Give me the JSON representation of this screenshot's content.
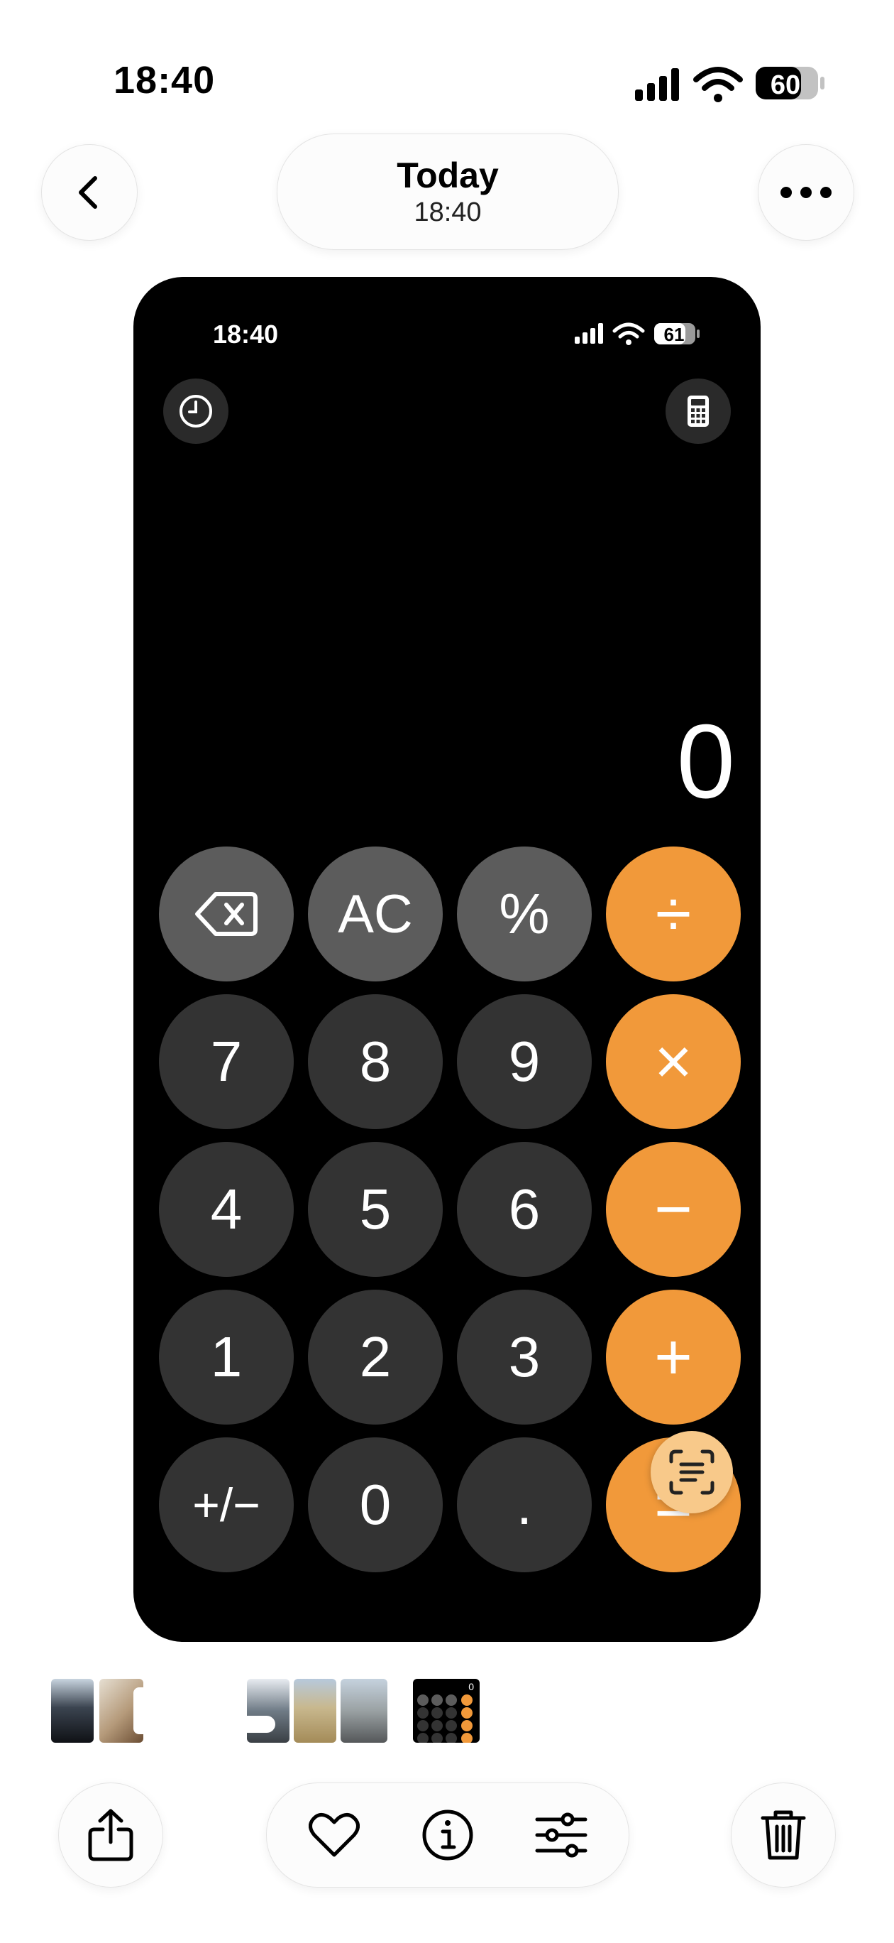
{
  "status_bar": {
    "time": "18:40",
    "battery": "60"
  },
  "nav": {
    "title": "Today",
    "subtitle": "18:40",
    "back_icon": "chevron-left-icon",
    "more_icon": "ellipsis-icon"
  },
  "screenshot": {
    "status_time": "18:40",
    "battery": "61",
    "display_value": "0",
    "keys": [
      [
        "⌫",
        "AC",
        "%",
        "÷"
      ],
      [
        "7",
        "8",
        "9",
        "×"
      ],
      [
        "4",
        "5",
        "6",
        "−"
      ],
      [
        "1",
        "2",
        "3",
        "+"
      ],
      [
        "+/−",
        "0",
        ".",
        "="
      ]
    ],
    "thumb_display": "0"
  },
  "toolbar": {
    "share_icon": "share-icon",
    "favorite_icon": "heart-icon",
    "info_icon": "info-icon",
    "adjust_icon": "sliders-icon",
    "delete_icon": "trash-icon"
  },
  "colors": {
    "operator": "#f1993a",
    "function_key": "#5c5c5c",
    "number_key": "#333333"
  }
}
